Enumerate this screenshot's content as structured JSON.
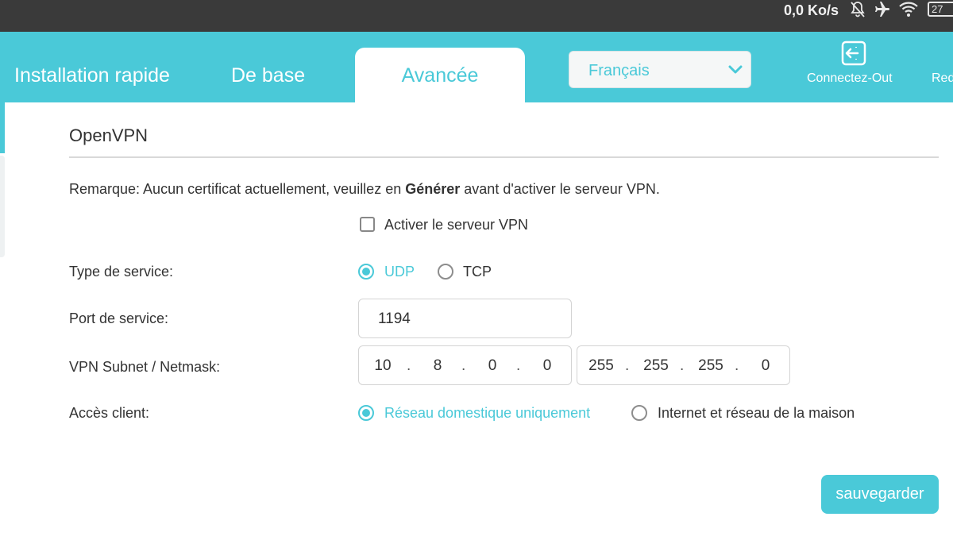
{
  "status_bar": {
    "speed": "0,0 Ko/s",
    "battery": "27",
    "icons": [
      "bell-off-icon",
      "airplane-icon",
      "wifi-icon",
      "battery-icon"
    ]
  },
  "nav": {
    "tabs": [
      {
        "label": "Installation rapide",
        "active": false
      },
      {
        "label": "De base",
        "active": false
      },
      {
        "label": "Avancée",
        "active": true
      }
    ],
    "language": {
      "selected": "Français"
    },
    "logout_label": "Connectez-Out",
    "reboot_label": "Red"
  },
  "section": {
    "title": "OpenVPN",
    "note_prefix": "Remarque: Aucun certificat actuellement, veuillez en ",
    "note_bold": "Générer",
    "note_suffix": " avant d'activer le serveur VPN."
  },
  "form": {
    "enable_vpn": {
      "label": "Activer le serveur VPN",
      "checked": false
    },
    "service_type": {
      "label": "Type de service:",
      "options": [
        {
          "label": "UDP",
          "selected": true
        },
        {
          "label": "TCP",
          "selected": false
        }
      ]
    },
    "service_port": {
      "label": "Port de service:",
      "value": "1194"
    },
    "subnet": {
      "label": "VPN Subnet / Netmask:",
      "subnet_octets": [
        "10",
        "8",
        "0",
        "0"
      ],
      "netmask_octets": [
        "255",
        "255",
        "255",
        "0"
      ]
    },
    "client_access": {
      "label": "Accès client:",
      "options": [
        {
          "label": "Réseau domestique uniquement",
          "selected": true
        },
        {
          "label": "Internet et réseau de la maison",
          "selected": false
        }
      ]
    }
  },
  "actions": {
    "save_label": "sauvegarder"
  },
  "colors": {
    "accent": "#4ac9d8",
    "status_bar": "#3a3a3a",
    "text": "#333333"
  }
}
